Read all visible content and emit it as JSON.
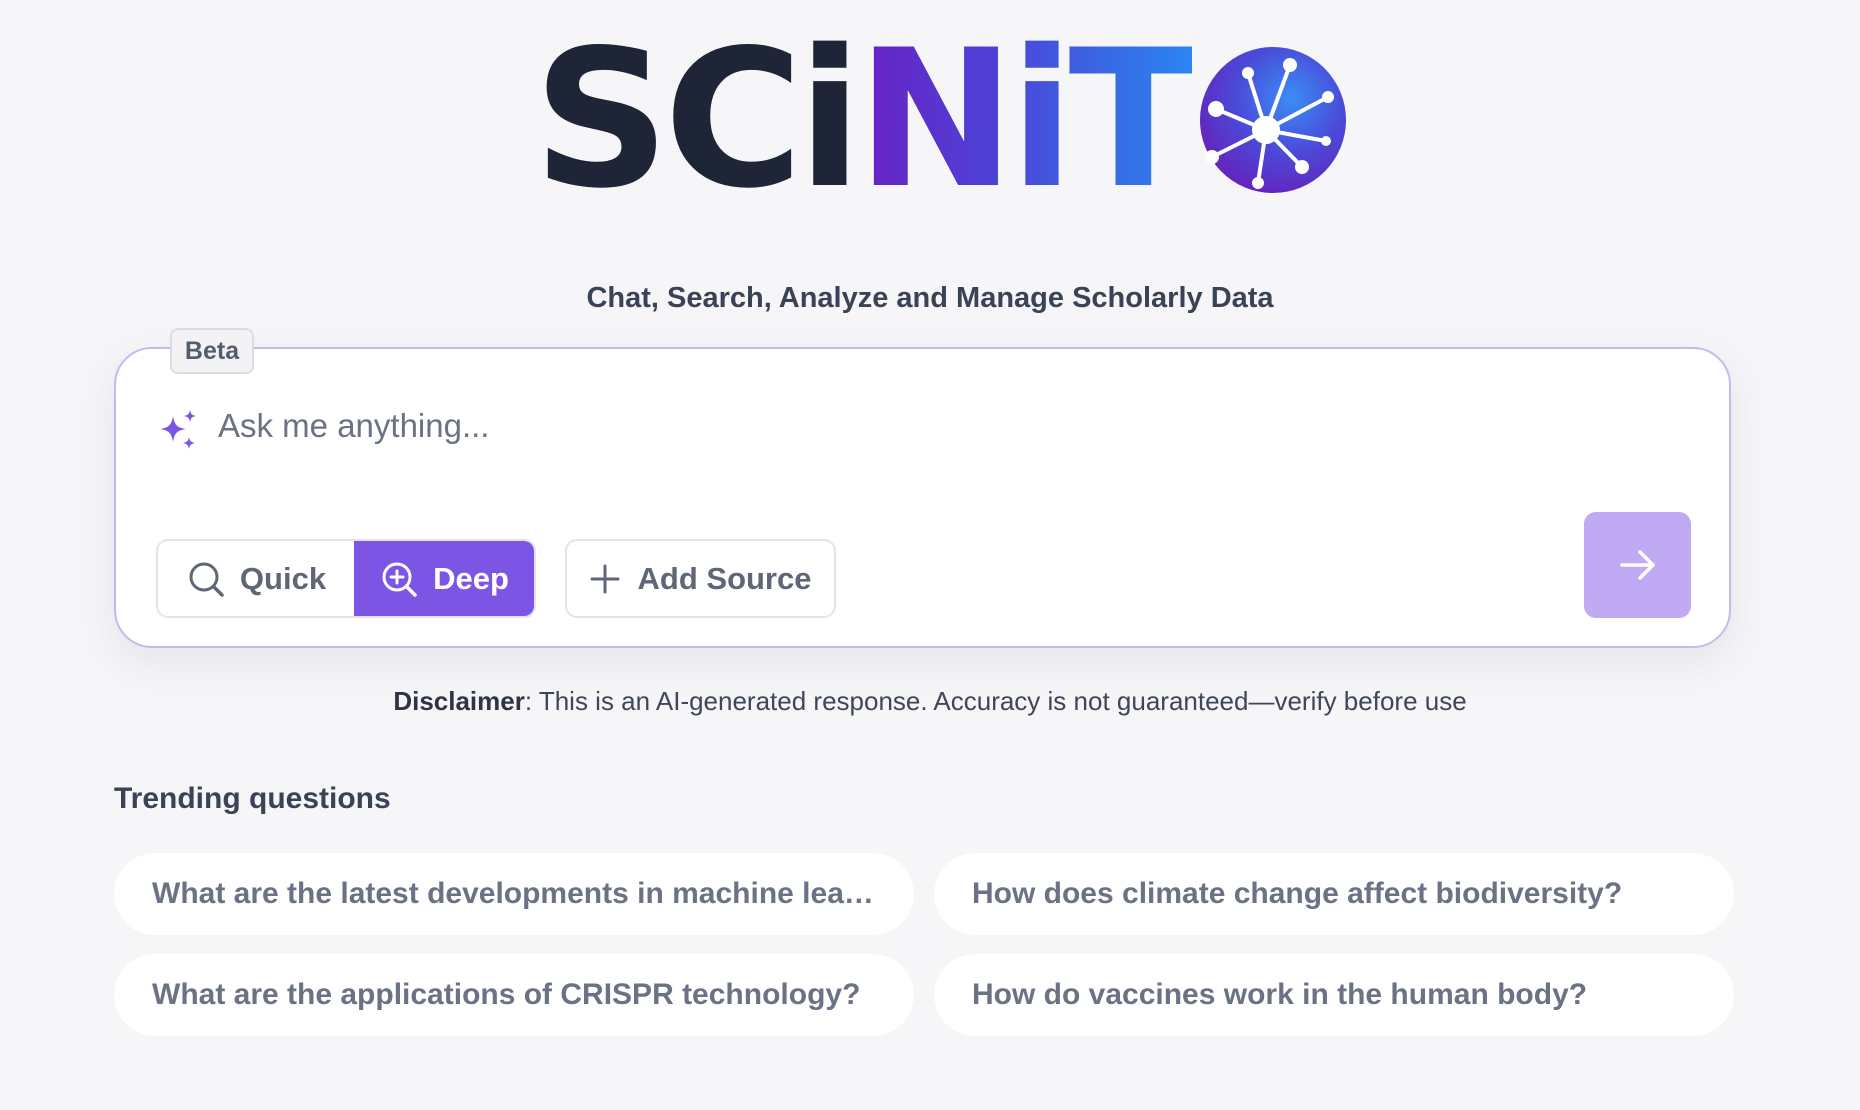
{
  "logo": {
    "text_dark": "SCi",
    "text_gradient": "NiT",
    "icon": "network-globe-icon"
  },
  "tagline": "Chat, Search, Analyze and Manage Scholarly Data",
  "search": {
    "badge": "Beta",
    "placeholder": "Ask me anything...",
    "icon": "sparkle-icon",
    "modes": [
      {
        "label": "Quick",
        "icon": "search-icon",
        "selected": false
      },
      {
        "label": "Deep",
        "icon": "zoom-in-icon",
        "selected": true
      }
    ],
    "add_source_label": "Add Source",
    "add_source_icon": "plus-icon",
    "send_icon": "arrow-right-icon"
  },
  "disclaimer": {
    "label": "Disclaimer",
    "text": ": This is an AI-generated response. Accuracy is not guaranteed—verify before use"
  },
  "trending": {
    "title": "Trending questions",
    "questions": [
      "What are the latest developments in machine learning?",
      "How does climate change affect biodiversity?",
      "What are the applications of CRISPR technology?",
      "How do vaccines work in the human body?"
    ]
  },
  "colors": {
    "accent": "#7c55e4",
    "send_button": "#c0aaf3",
    "card_border": "#c8b8f0",
    "background": "#f6f6f8",
    "text_dark": "#1e2536"
  }
}
